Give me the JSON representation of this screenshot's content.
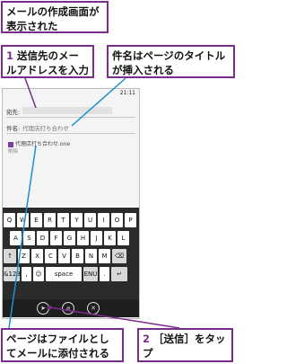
{
  "callouts": {
    "c1": "メールの作成画面が表示された",
    "c2_num": "1",
    "c2_text": "送信先のメールアドレスを入力",
    "c3": "件名はページのタイトルが挿入される",
    "c4": "ページはファイルとしてメールに添付される",
    "c5_num": "2",
    "c5_text": "［送信］をタップ"
  },
  "phone": {
    "time": "21:11",
    "to_label": "宛先:",
    "subject_label": "件名:",
    "subject_value": "代理店打ち合わせ",
    "attachment_name": "代理店打ち合わせ.one",
    "attachment_note": "削除"
  },
  "keyboard": {
    "row1": [
      "Q",
      "W",
      "E",
      "R",
      "T",
      "Y",
      "U",
      "I",
      "O",
      "P"
    ],
    "row2": [
      "A",
      "S",
      "D",
      "F",
      "G",
      "H",
      "J",
      "K",
      "L"
    ],
    "row3": [
      "↑",
      "Z",
      "X",
      "C",
      "V",
      "B",
      "N",
      "M",
      "⌫"
    ],
    "row4": [
      "&123",
      ",",
      "☺",
      "space",
      "ENU",
      ".",
      "↵"
    ]
  },
  "appbar": {
    "send_icon": "send-icon",
    "attach_icon": "attach-icon",
    "discard_icon": "discard-icon"
  }
}
